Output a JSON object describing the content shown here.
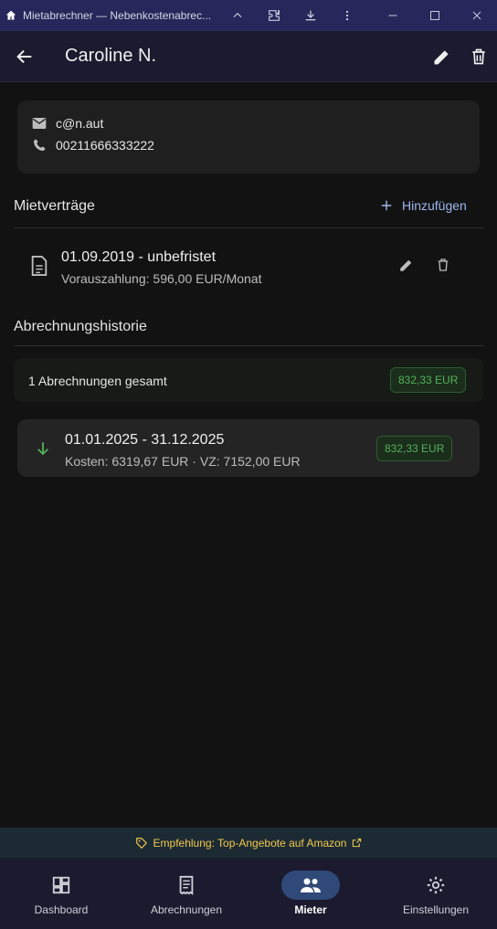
{
  "window": {
    "title": "Mietabrechner — Nebenkostenabrec...",
    "icons": [
      "home-icon",
      "chevron-up-icon",
      "extension-icon",
      "download-icon",
      "more-vert-icon",
      "minimize-icon",
      "maximize-icon",
      "close-icon"
    ]
  },
  "appbar": {
    "title": "Caroline N."
  },
  "contact": {
    "email": "c@n.aut",
    "phone": "00211666333222"
  },
  "contracts": {
    "section_title": "Mietverträge",
    "add_label": "Hinzufügen",
    "items": [
      {
        "title": "01.09.2019 - unbefristet",
        "subtitle": "Vorauszahlung: 596,00 EUR/Monat"
      }
    ]
  },
  "history": {
    "section_title": "Abrechnungshistorie",
    "summary_label": "1 Abrechnungen gesamt",
    "summary_amount": "832,33 EUR",
    "items": [
      {
        "period": "01.01.2025 - 31.12.2025",
        "details": "Kosten: 6319,67 EUR · VZ: 7152,00 EUR",
        "amount": "832,33 EUR"
      }
    ]
  },
  "promo": {
    "text": "Empfehlung: Top-Angebote auf Amazon"
  },
  "nav": {
    "items": [
      {
        "label": "Dashboard",
        "icon": "dashboard-icon",
        "active": false
      },
      {
        "label": "Abrechnungen",
        "icon": "receipt-icon",
        "active": false
      },
      {
        "label": "Mieter",
        "icon": "people-icon",
        "active": true
      },
      {
        "label": "Einstellungen",
        "icon": "gear-icon",
        "active": false
      }
    ]
  },
  "colors": {
    "accent": "#9db8ef",
    "positive": "#56b05c",
    "promo": "#f2c94c",
    "nav_active": "#2f4a78"
  }
}
